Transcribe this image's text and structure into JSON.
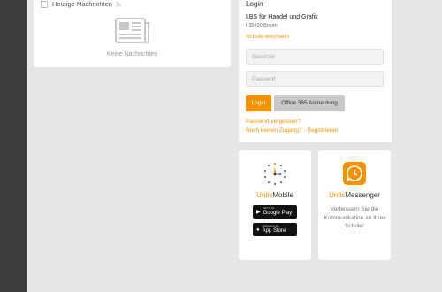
{
  "news": {
    "title": "Heutige Nachrichten",
    "empty": "Keine Nachrichten"
  },
  "login": {
    "title": "Login",
    "school_name": "LBS für Handel und Grafik",
    "school_address": "I-39100 Bozen",
    "switch_school": "Schule wechseln",
    "username_placeholder": "Benutzer",
    "password_placeholder": "Passwort",
    "login_button": "Login",
    "o365_button": "Office 365 Anmeldung",
    "forgot_password": "Passwort vergessen?",
    "register": "Noch keinen Zugang? - Registrieren"
  },
  "untis_mobile": {
    "title_accent": "Untis",
    "title_rest": "Mobile",
    "google_small": "GET IT ON",
    "google_big": "Google Play",
    "apple_small": "Download on the",
    "apple_big": "App Store"
  },
  "untis_messenger": {
    "title_accent": "Untis",
    "title_rest": "Messenger",
    "description": "Verbessern Sie die Kommunikation an Ihrer Schule!"
  },
  "colors": {
    "accent": "#f39200",
    "background": "#e6e6e6",
    "sidebar": "#3c3c3c"
  },
  "icons": [
    "newspaper-icon",
    "rss-icon",
    "untis-mobile-clock-icon",
    "untis-messenger-icon",
    "google-play-icon",
    "apple-icon"
  ]
}
